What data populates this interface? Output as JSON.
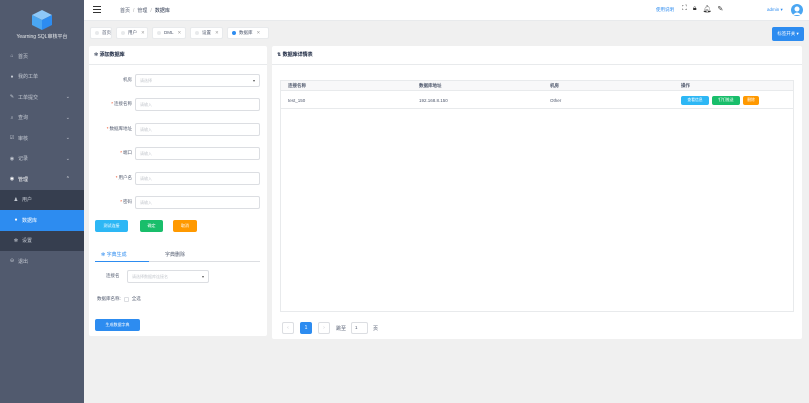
{
  "app": {
    "logo_icon": "cube-logo-icon",
    "name": "Yearning SQL审核平台",
    "colors": {
      "sidebar": "#515a6e",
      "primary": "#2d8cf0",
      "success": "#19be6b",
      "warning": "#ff9900",
      "info": "#2db7f5"
    }
  },
  "sidebar": {
    "items": [
      {
        "icon": "home-icon",
        "glyph": "⌂",
        "label": "首页",
        "chevron": ""
      },
      {
        "icon": "user-icon",
        "glyph": "●",
        "label": "我的工单",
        "chevron": ""
      },
      {
        "icon": "edit-icon",
        "glyph": "✎",
        "label": "工单提交",
        "chevron": "⌄"
      },
      {
        "icon": "search-icon",
        "glyph": "⌕",
        "label": "查询",
        "chevron": "⌄"
      },
      {
        "icon": "audit-icon",
        "glyph": "☑",
        "label": "审核",
        "chevron": "⌄"
      },
      {
        "icon": "record-icon",
        "glyph": "◉",
        "label": "记录",
        "chevron": "⌄"
      },
      {
        "icon": "manage-icon",
        "glyph": "◉",
        "label": "管理",
        "chevron": "⌃"
      },
      {
        "icon": "users-icon",
        "glyph": "♟",
        "label": "用户",
        "chevron": ""
      },
      {
        "icon": "database-icon",
        "glyph": "●",
        "label": "数据库",
        "chevron": ""
      },
      {
        "icon": "settings-icon",
        "glyph": "✻",
        "label": "设置",
        "chevron": ""
      },
      {
        "icon": "logout-icon",
        "glyph": "⊖",
        "label": "退出",
        "chevron": ""
      }
    ]
  },
  "header": {
    "breadcrumb": [
      "首页",
      "管理",
      "数据库"
    ],
    "help_link": "使用说明",
    "icons": [
      "fullscreen-icon",
      "lock-icon",
      "bell-icon",
      "theme-icon"
    ],
    "user": "admin ▾"
  },
  "tags": {
    "items": [
      {
        "label": "首页",
        "closable": false
      },
      {
        "label": "用户",
        "closable": true
      },
      {
        "label": "DML",
        "closable": true
      },
      {
        "label": "设置",
        "closable": true
      },
      {
        "label": "数据库",
        "closable": true
      }
    ],
    "nav_label": "标签开关 ▾"
  },
  "form": {
    "title": "添加数据库",
    "fields": [
      {
        "label": "机房",
        "required": false,
        "placeholder": "请选择",
        "select": true
      },
      {
        "label": "连接名称",
        "required": true,
        "placeholder": "请输入",
        "select": false
      },
      {
        "label": "数据库地址",
        "required": true,
        "placeholder": "请输入",
        "select": false
      },
      {
        "label": "端口",
        "required": true,
        "placeholder": "请输入",
        "select": false
      },
      {
        "label": "用户名",
        "required": true,
        "placeholder": "请输入",
        "select": false
      },
      {
        "label": "密码",
        "required": true,
        "placeholder": "请输入",
        "select": false
      }
    ],
    "test_button": "测试连接",
    "ok_button": "确定",
    "cancel_button": "取消",
    "tabs": [
      "字典生成",
      "字典删除"
    ],
    "conn_label": "连接名",
    "conn_placeholder": "请选择数据库连接名",
    "db_label": "数据库名称:",
    "select_all": "全选",
    "generate_button": "生成数据字典"
  },
  "details": {
    "title": "数据库详情表",
    "columns": [
      "连接名称",
      "数据库地址",
      "机房",
      "操作"
    ],
    "rows": [
      {
        "name": "test_150",
        "address": "192.168.8.150",
        "room": "Other",
        "actions": [
          "查看信息",
          "钉钉推送",
          "删除"
        ]
      }
    ],
    "pager": {
      "current": "1",
      "jump_label": "跳至",
      "jump_value": "1",
      "page_suffix": "页"
    }
  }
}
